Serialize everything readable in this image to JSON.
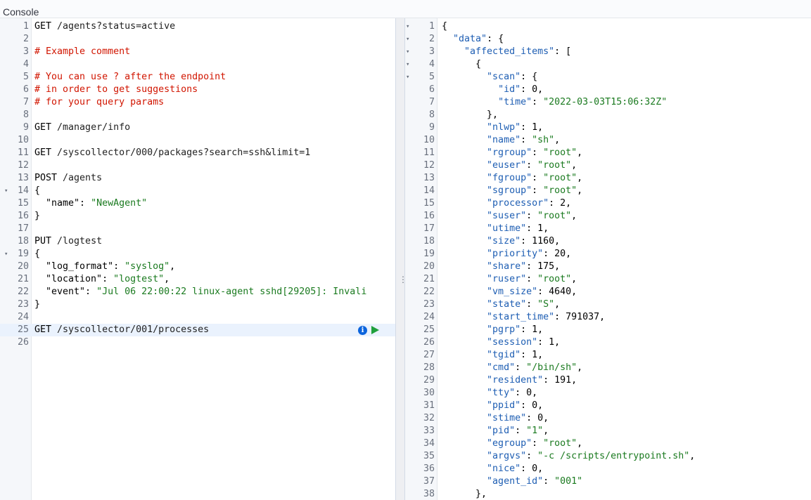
{
  "header": {
    "title": "Console"
  },
  "request_editor": {
    "lines": [
      {
        "n": "1",
        "tokens": [
          {
            "t": "GET ",
            "c": "c-key"
          },
          {
            "t": "/agents?status=active",
            "c": "c-path"
          }
        ]
      },
      {
        "n": "2",
        "tokens": []
      },
      {
        "n": "3",
        "tokens": [
          {
            "t": "# Example comment",
            "c": "c-comment"
          }
        ]
      },
      {
        "n": "4",
        "tokens": []
      },
      {
        "n": "5",
        "tokens": [
          {
            "t": "# You can use ? after the endpoint",
            "c": "c-comment"
          }
        ]
      },
      {
        "n": "6",
        "tokens": [
          {
            "t": "# in order to get suggestions",
            "c": "c-comment"
          }
        ]
      },
      {
        "n": "7",
        "tokens": [
          {
            "t": "# for your query params",
            "c": "c-comment"
          }
        ]
      },
      {
        "n": "8",
        "tokens": []
      },
      {
        "n": "9",
        "tokens": [
          {
            "t": "GET ",
            "c": "c-key"
          },
          {
            "t": "/manager/info",
            "c": "c-path"
          }
        ]
      },
      {
        "n": "10",
        "tokens": []
      },
      {
        "n": "11",
        "tokens": [
          {
            "t": "GET ",
            "c": "c-key"
          },
          {
            "t": "/syscollector/000/packages?search=ssh&limit=1",
            "c": "c-path"
          }
        ]
      },
      {
        "n": "12",
        "tokens": []
      },
      {
        "n": "13",
        "tokens": [
          {
            "t": "POST ",
            "c": "c-key"
          },
          {
            "t": "/agents",
            "c": "c-path"
          }
        ]
      },
      {
        "n": "14",
        "fold": true,
        "tokens": [
          {
            "t": "{",
            "c": "c-plain"
          }
        ]
      },
      {
        "n": "15",
        "tokens": [
          {
            "t": "  \"name\": ",
            "c": "c-plain"
          },
          {
            "t": "\"NewAgent\"",
            "c": "c-string"
          }
        ]
      },
      {
        "n": "16",
        "tokens": [
          {
            "t": "}",
            "c": "c-plain"
          }
        ]
      },
      {
        "n": "17",
        "tokens": []
      },
      {
        "n": "18",
        "tokens": [
          {
            "t": "PUT ",
            "c": "c-key"
          },
          {
            "t": "/logtest",
            "c": "c-path"
          }
        ]
      },
      {
        "n": "19",
        "fold": true,
        "tokens": [
          {
            "t": "{",
            "c": "c-plain"
          }
        ]
      },
      {
        "n": "20",
        "tokens": [
          {
            "t": "  \"log_format\": ",
            "c": "c-plain"
          },
          {
            "t": "\"syslog\"",
            "c": "c-string"
          },
          {
            "t": ",",
            "c": "c-plain"
          }
        ]
      },
      {
        "n": "21",
        "tokens": [
          {
            "t": "  \"location\": ",
            "c": "c-plain"
          },
          {
            "t": "\"logtest\"",
            "c": "c-string"
          },
          {
            "t": ",",
            "c": "c-plain"
          }
        ]
      },
      {
        "n": "22",
        "tokens": [
          {
            "t": "  \"event\": ",
            "c": "c-plain"
          },
          {
            "t": "\"Jul 06 22:00:22 linux-agent sshd[29205]: Invali",
            "c": "c-string"
          }
        ]
      },
      {
        "n": "23",
        "tokens": [
          {
            "t": "}",
            "c": "c-plain"
          }
        ]
      },
      {
        "n": "24",
        "tokens": []
      },
      {
        "n": "25",
        "active": true,
        "tokens": [
          {
            "t": "GET ",
            "c": "c-key"
          },
          {
            "t": "/syscollector/001/processes",
            "c": "c-path"
          }
        ]
      },
      {
        "n": "26",
        "tokens": []
      }
    ]
  },
  "response_viewer": {
    "lines": [
      {
        "n": "1",
        "fold": true,
        "tokens": [
          {
            "t": "{",
            "c": "c-plain"
          }
        ]
      },
      {
        "n": "2",
        "fold": true,
        "tokens": [
          {
            "t": "  ",
            "c": "c-plain"
          },
          {
            "t": "\"data\"",
            "c": "c-jkey"
          },
          {
            "t": ": {",
            "c": "c-plain"
          }
        ]
      },
      {
        "n": "3",
        "fold": true,
        "tokens": [
          {
            "t": "    ",
            "c": "c-plain"
          },
          {
            "t": "\"affected_items\"",
            "c": "c-jkey"
          },
          {
            "t": ": [",
            "c": "c-plain"
          }
        ]
      },
      {
        "n": "4",
        "fold": true,
        "tokens": [
          {
            "t": "      {",
            "c": "c-plain"
          }
        ]
      },
      {
        "n": "5",
        "fold": true,
        "tokens": [
          {
            "t": "        ",
            "c": "c-plain"
          },
          {
            "t": "\"scan\"",
            "c": "c-jkey"
          },
          {
            "t": ": {",
            "c": "c-plain"
          }
        ]
      },
      {
        "n": "6",
        "tokens": [
          {
            "t": "          ",
            "c": "c-plain"
          },
          {
            "t": "\"id\"",
            "c": "c-jkey"
          },
          {
            "t": ": 0,",
            "c": "c-plain"
          }
        ]
      },
      {
        "n": "7",
        "tokens": [
          {
            "t": "          ",
            "c": "c-plain"
          },
          {
            "t": "\"time\"",
            "c": "c-jkey"
          },
          {
            "t": ": ",
            "c": "c-plain"
          },
          {
            "t": "\"2022-03-03T15:06:32Z\"",
            "c": "c-string"
          }
        ]
      },
      {
        "n": "8",
        "tokens": [
          {
            "t": "        },",
            "c": "c-plain"
          }
        ]
      },
      {
        "n": "9",
        "tokens": [
          {
            "t": "        ",
            "c": "c-plain"
          },
          {
            "t": "\"nlwp\"",
            "c": "c-jkey"
          },
          {
            "t": ": 1,",
            "c": "c-plain"
          }
        ]
      },
      {
        "n": "10",
        "tokens": [
          {
            "t": "        ",
            "c": "c-plain"
          },
          {
            "t": "\"name\"",
            "c": "c-jkey"
          },
          {
            "t": ": ",
            "c": "c-plain"
          },
          {
            "t": "\"sh\"",
            "c": "c-string"
          },
          {
            "t": ",",
            "c": "c-plain"
          }
        ]
      },
      {
        "n": "11",
        "tokens": [
          {
            "t": "        ",
            "c": "c-plain"
          },
          {
            "t": "\"rgroup\"",
            "c": "c-jkey"
          },
          {
            "t": ": ",
            "c": "c-plain"
          },
          {
            "t": "\"root\"",
            "c": "c-string"
          },
          {
            "t": ",",
            "c": "c-plain"
          }
        ]
      },
      {
        "n": "12",
        "tokens": [
          {
            "t": "        ",
            "c": "c-plain"
          },
          {
            "t": "\"euser\"",
            "c": "c-jkey"
          },
          {
            "t": ": ",
            "c": "c-plain"
          },
          {
            "t": "\"root\"",
            "c": "c-string"
          },
          {
            "t": ",",
            "c": "c-plain"
          }
        ]
      },
      {
        "n": "13",
        "tokens": [
          {
            "t": "        ",
            "c": "c-plain"
          },
          {
            "t": "\"fgroup\"",
            "c": "c-jkey"
          },
          {
            "t": ": ",
            "c": "c-plain"
          },
          {
            "t": "\"root\"",
            "c": "c-string"
          },
          {
            "t": ",",
            "c": "c-plain"
          }
        ]
      },
      {
        "n": "14",
        "tokens": [
          {
            "t": "        ",
            "c": "c-plain"
          },
          {
            "t": "\"sgroup\"",
            "c": "c-jkey"
          },
          {
            "t": ": ",
            "c": "c-plain"
          },
          {
            "t": "\"root\"",
            "c": "c-string"
          },
          {
            "t": ",",
            "c": "c-plain"
          }
        ]
      },
      {
        "n": "15",
        "tokens": [
          {
            "t": "        ",
            "c": "c-plain"
          },
          {
            "t": "\"processor\"",
            "c": "c-jkey"
          },
          {
            "t": ": 2,",
            "c": "c-plain"
          }
        ]
      },
      {
        "n": "16",
        "tokens": [
          {
            "t": "        ",
            "c": "c-plain"
          },
          {
            "t": "\"suser\"",
            "c": "c-jkey"
          },
          {
            "t": ": ",
            "c": "c-plain"
          },
          {
            "t": "\"root\"",
            "c": "c-string"
          },
          {
            "t": ",",
            "c": "c-plain"
          }
        ]
      },
      {
        "n": "17",
        "tokens": [
          {
            "t": "        ",
            "c": "c-plain"
          },
          {
            "t": "\"utime\"",
            "c": "c-jkey"
          },
          {
            "t": ": 1,",
            "c": "c-plain"
          }
        ]
      },
      {
        "n": "18",
        "tokens": [
          {
            "t": "        ",
            "c": "c-plain"
          },
          {
            "t": "\"size\"",
            "c": "c-jkey"
          },
          {
            "t": ": 1160,",
            "c": "c-plain"
          }
        ]
      },
      {
        "n": "19",
        "tokens": [
          {
            "t": "        ",
            "c": "c-plain"
          },
          {
            "t": "\"priority\"",
            "c": "c-jkey"
          },
          {
            "t": ": 20,",
            "c": "c-plain"
          }
        ]
      },
      {
        "n": "20",
        "tokens": [
          {
            "t": "        ",
            "c": "c-plain"
          },
          {
            "t": "\"share\"",
            "c": "c-jkey"
          },
          {
            "t": ": 175,",
            "c": "c-plain"
          }
        ]
      },
      {
        "n": "21",
        "tokens": [
          {
            "t": "        ",
            "c": "c-plain"
          },
          {
            "t": "\"ruser\"",
            "c": "c-jkey"
          },
          {
            "t": ": ",
            "c": "c-plain"
          },
          {
            "t": "\"root\"",
            "c": "c-string"
          },
          {
            "t": ",",
            "c": "c-plain"
          }
        ]
      },
      {
        "n": "22",
        "tokens": [
          {
            "t": "        ",
            "c": "c-plain"
          },
          {
            "t": "\"vm_size\"",
            "c": "c-jkey"
          },
          {
            "t": ": 4640,",
            "c": "c-plain"
          }
        ]
      },
      {
        "n": "23",
        "tokens": [
          {
            "t": "        ",
            "c": "c-plain"
          },
          {
            "t": "\"state\"",
            "c": "c-jkey"
          },
          {
            "t": ": ",
            "c": "c-plain"
          },
          {
            "t": "\"S\"",
            "c": "c-string"
          },
          {
            "t": ",",
            "c": "c-plain"
          }
        ]
      },
      {
        "n": "24",
        "tokens": [
          {
            "t": "        ",
            "c": "c-plain"
          },
          {
            "t": "\"start_time\"",
            "c": "c-jkey"
          },
          {
            "t": ": 791037,",
            "c": "c-plain"
          }
        ]
      },
      {
        "n": "25",
        "tokens": [
          {
            "t": "        ",
            "c": "c-plain"
          },
          {
            "t": "\"pgrp\"",
            "c": "c-jkey"
          },
          {
            "t": ": 1,",
            "c": "c-plain"
          }
        ]
      },
      {
        "n": "26",
        "tokens": [
          {
            "t": "        ",
            "c": "c-plain"
          },
          {
            "t": "\"session\"",
            "c": "c-jkey"
          },
          {
            "t": ": 1,",
            "c": "c-plain"
          }
        ]
      },
      {
        "n": "27",
        "tokens": [
          {
            "t": "        ",
            "c": "c-plain"
          },
          {
            "t": "\"tgid\"",
            "c": "c-jkey"
          },
          {
            "t": ": 1,",
            "c": "c-plain"
          }
        ]
      },
      {
        "n": "28",
        "tokens": [
          {
            "t": "        ",
            "c": "c-plain"
          },
          {
            "t": "\"cmd\"",
            "c": "c-jkey"
          },
          {
            "t": ": ",
            "c": "c-plain"
          },
          {
            "t": "\"/bin/sh\"",
            "c": "c-string"
          },
          {
            "t": ",",
            "c": "c-plain"
          }
        ]
      },
      {
        "n": "29",
        "tokens": [
          {
            "t": "        ",
            "c": "c-plain"
          },
          {
            "t": "\"resident\"",
            "c": "c-jkey"
          },
          {
            "t": ": 191,",
            "c": "c-plain"
          }
        ]
      },
      {
        "n": "30",
        "tokens": [
          {
            "t": "        ",
            "c": "c-plain"
          },
          {
            "t": "\"tty\"",
            "c": "c-jkey"
          },
          {
            "t": ": 0,",
            "c": "c-plain"
          }
        ]
      },
      {
        "n": "31",
        "tokens": [
          {
            "t": "        ",
            "c": "c-plain"
          },
          {
            "t": "\"ppid\"",
            "c": "c-jkey"
          },
          {
            "t": ": 0,",
            "c": "c-plain"
          }
        ]
      },
      {
        "n": "32",
        "tokens": [
          {
            "t": "        ",
            "c": "c-plain"
          },
          {
            "t": "\"stime\"",
            "c": "c-jkey"
          },
          {
            "t": ": 0,",
            "c": "c-plain"
          }
        ]
      },
      {
        "n": "33",
        "tokens": [
          {
            "t": "        ",
            "c": "c-plain"
          },
          {
            "t": "\"pid\"",
            "c": "c-jkey"
          },
          {
            "t": ": ",
            "c": "c-plain"
          },
          {
            "t": "\"1\"",
            "c": "c-string"
          },
          {
            "t": ",",
            "c": "c-plain"
          }
        ]
      },
      {
        "n": "34",
        "tokens": [
          {
            "t": "        ",
            "c": "c-plain"
          },
          {
            "t": "\"egroup\"",
            "c": "c-jkey"
          },
          {
            "t": ": ",
            "c": "c-plain"
          },
          {
            "t": "\"root\"",
            "c": "c-string"
          },
          {
            "t": ",",
            "c": "c-plain"
          }
        ]
      },
      {
        "n": "35",
        "tokens": [
          {
            "t": "        ",
            "c": "c-plain"
          },
          {
            "t": "\"argvs\"",
            "c": "c-jkey"
          },
          {
            "t": ": ",
            "c": "c-plain"
          },
          {
            "t": "\"-c /scripts/entrypoint.sh\"",
            "c": "c-string"
          },
          {
            "t": ",",
            "c": "c-plain"
          }
        ]
      },
      {
        "n": "36",
        "tokens": [
          {
            "t": "        ",
            "c": "c-plain"
          },
          {
            "t": "\"nice\"",
            "c": "c-jkey"
          },
          {
            "t": ": 0,",
            "c": "c-plain"
          }
        ]
      },
      {
        "n": "37",
        "tokens": [
          {
            "t": "        ",
            "c": "c-plain"
          },
          {
            "t": "\"agent_id\"",
            "c": "c-jkey"
          },
          {
            "t": ": ",
            "c": "c-plain"
          },
          {
            "t": "\"001\"",
            "c": "c-string"
          }
        ]
      },
      {
        "n": "38",
        "tokens": [
          {
            "t": "      },",
            "c": "c-plain"
          }
        ]
      }
    ]
  },
  "icons": {
    "fold": "fold-arrow-icon",
    "info": "info-icon",
    "run": "play-icon",
    "resize": "drag-handle-icon"
  },
  "glyphs": {
    "fold": "▾",
    "info": "i",
    "grip": "⋮"
  },
  "colors": {
    "comment": "#d11500",
    "string": "#1a7a1f",
    "json_key": "#1e5eb3",
    "info": "#0b64dd",
    "run": "#20a03c",
    "active_line": "#eaf2fd"
  }
}
